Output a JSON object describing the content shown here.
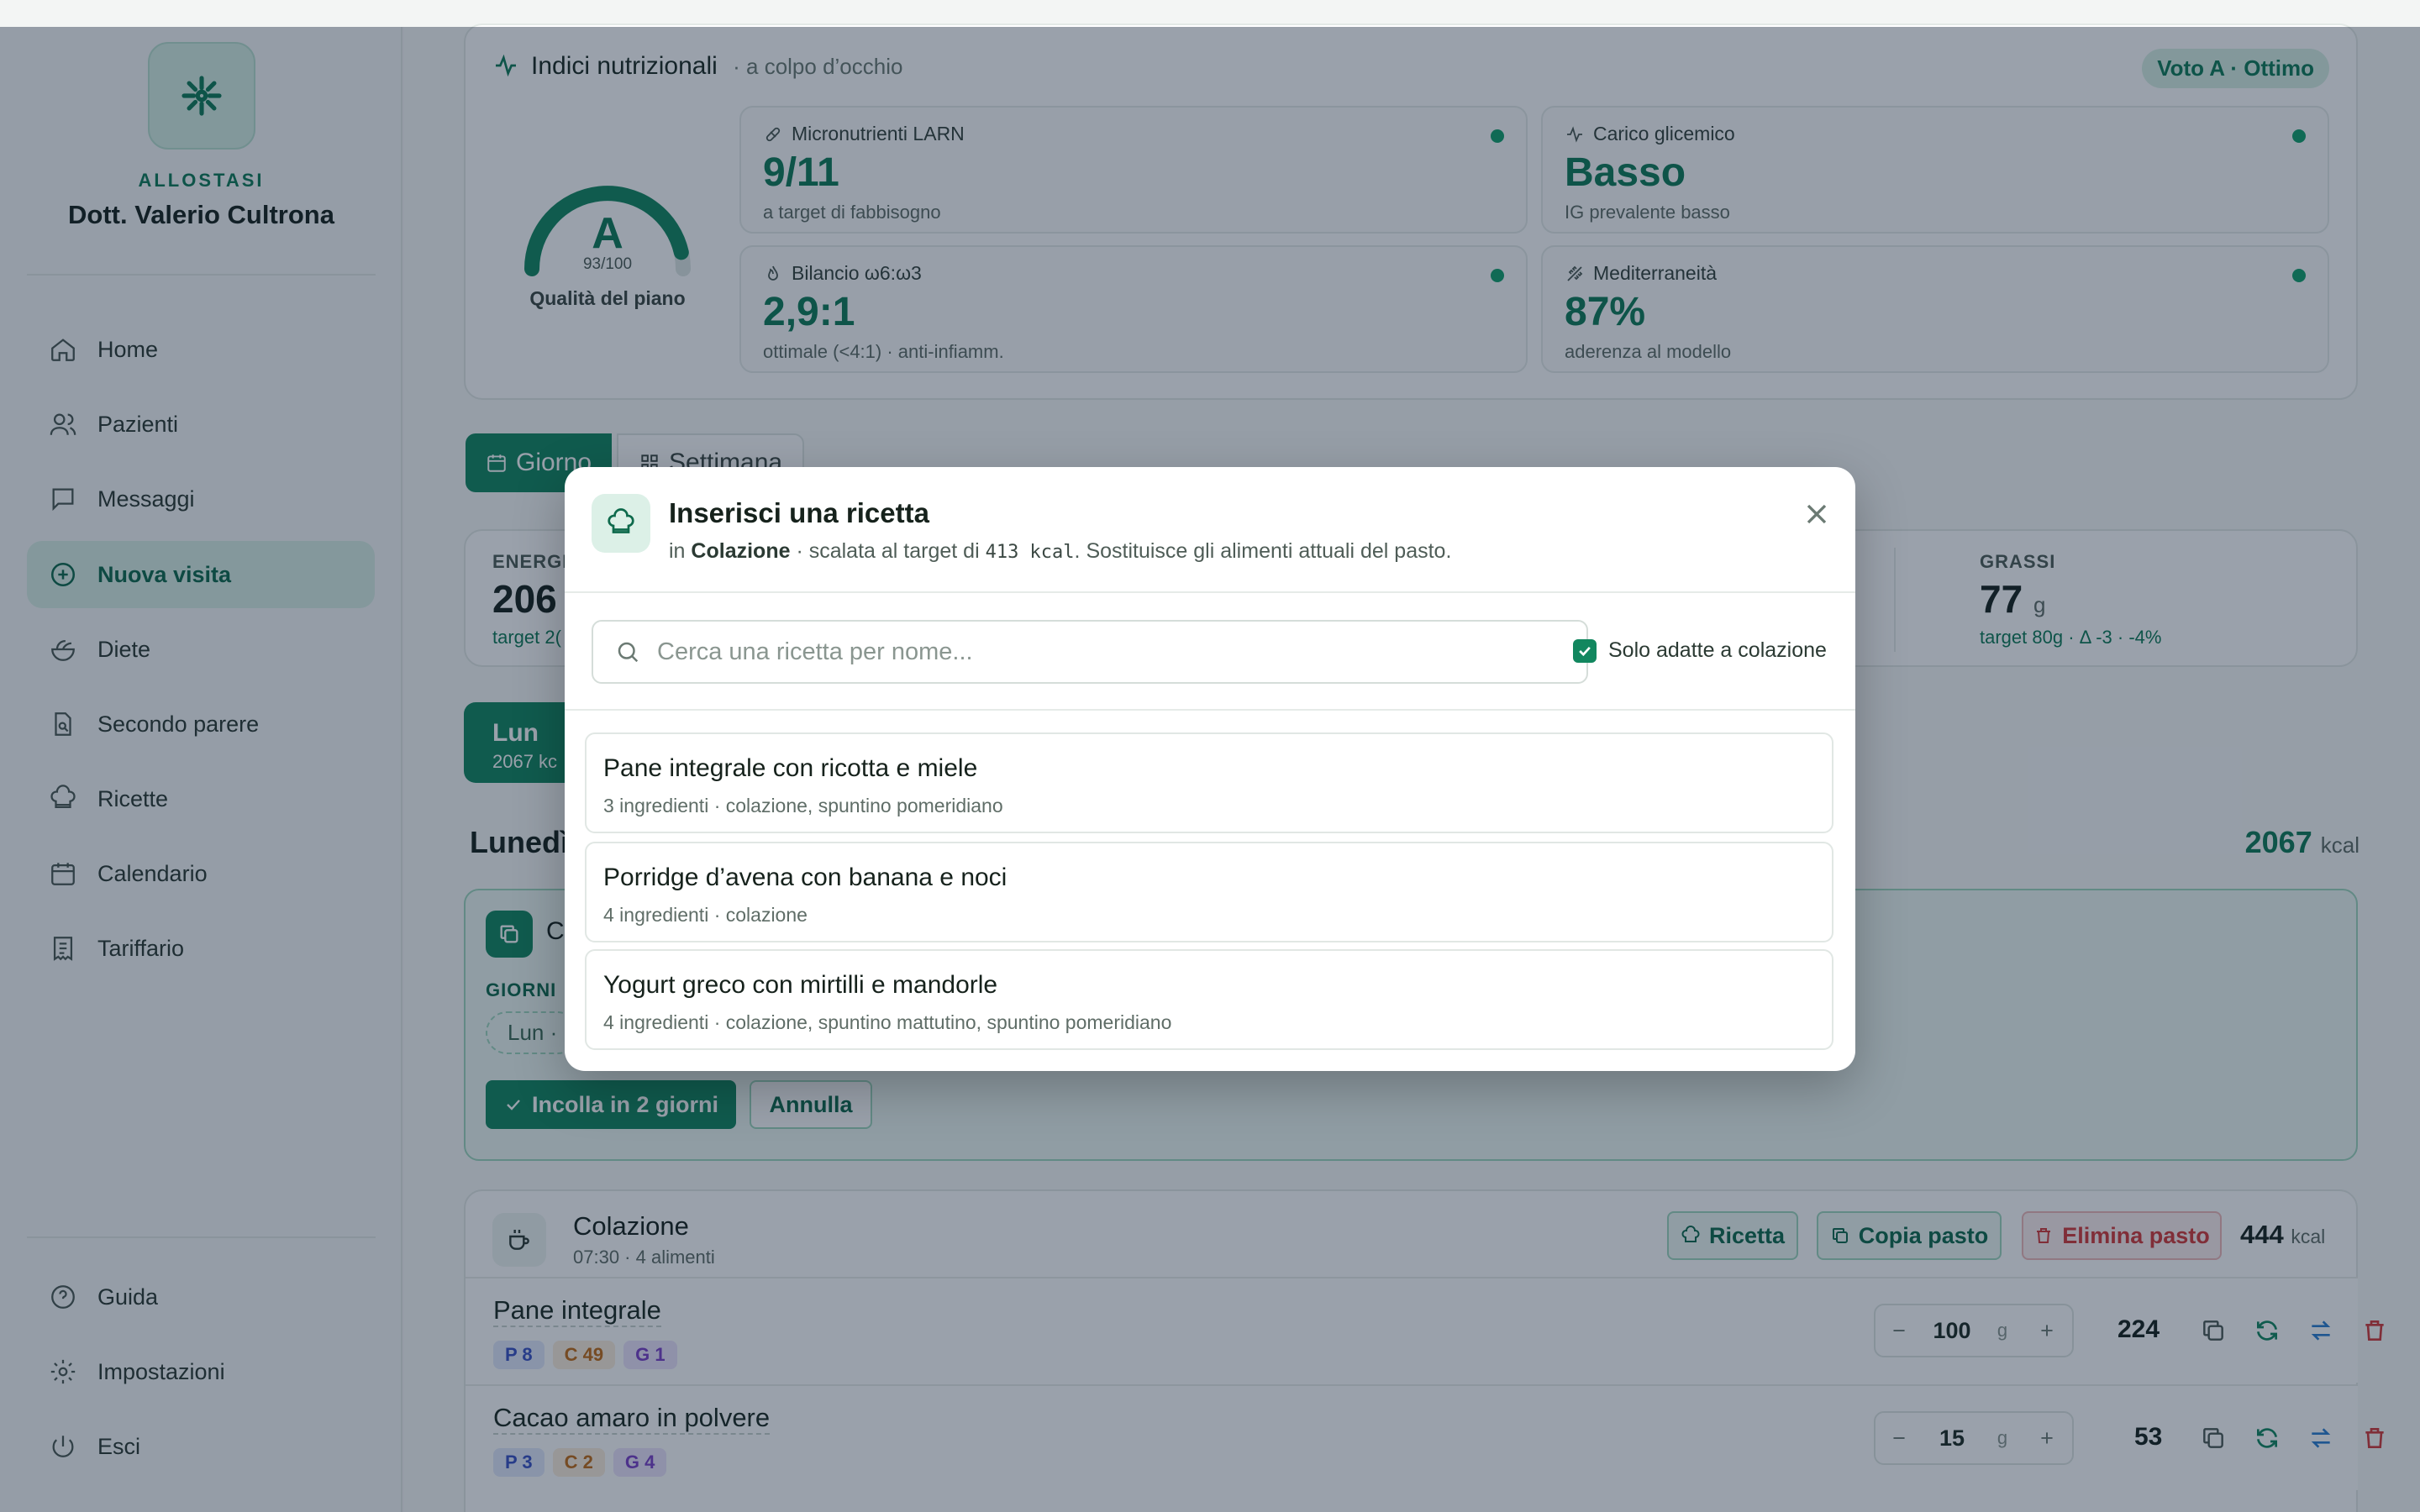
{
  "sidebar": {
    "brand_small": "ALLOSTASI",
    "brand_name": "Dott. Valerio Cultrona",
    "items": [
      {
        "label": "Home",
        "icon": "home-icon"
      },
      {
        "label": "Pazienti",
        "icon": "users-icon"
      },
      {
        "label": "Messaggi",
        "icon": "message-icon"
      },
      {
        "label": "Nuova visita",
        "icon": "plus-circle-icon",
        "active": true
      },
      {
        "label": "Diete",
        "icon": "salad-icon"
      },
      {
        "label": "Secondo parere",
        "icon": "file-search-icon"
      },
      {
        "label": "Ricette",
        "icon": "chef-hat-icon"
      },
      {
        "label": "Calendario",
        "icon": "calendar-icon"
      },
      {
        "label": "Tariffario",
        "icon": "receipt-icon"
      }
    ],
    "bottom_items": [
      {
        "label": "Guida",
        "icon": "help-icon"
      },
      {
        "label": "Impostazioni",
        "icon": "gear-icon"
      },
      {
        "label": "Esci",
        "icon": "power-icon"
      }
    ]
  },
  "indices": {
    "title": "Indici nutrizionali",
    "subtitle": "· a colpo d’occhio",
    "badge": "Voto A · Ottimo",
    "grade": "A",
    "score": "93/100",
    "score_value": 93,
    "quality_label": "Qualità del piano",
    "metrics": [
      {
        "label": "Micronutrienti LARN",
        "value": "9/11",
        "sub": "a target di fabbisogno"
      },
      {
        "label": "Carico glicemico",
        "value": "Basso",
        "sub": "IG prevalente basso"
      },
      {
        "label": "Bilancio ω6:ω3",
        "value": "2,9:1",
        "sub": "ottimale (<4:1) · anti-infiamm."
      },
      {
        "label": "Mediterraneità",
        "value": "87%",
        "sub": "aderenza al modello"
      }
    ]
  },
  "view_tabs": {
    "day": "Giorno",
    "week": "Settimana"
  },
  "macros": {
    "energy_label": "ENERGI",
    "energy_value": "206",
    "energy_sub": "target 2(",
    "fat_label": "GRASSI",
    "fat_value": "77",
    "fat_unit": "g",
    "fat_sub": "target 80g · Δ -3 · -4%"
  },
  "day_chip": {
    "label": "Lun",
    "sub": "2067 kc"
  },
  "day_header": {
    "title": "Lunedì",
    "kcal_value": "2067",
    "kcal_unit": "kcal"
  },
  "copy_panel": {
    "label_partial": "C",
    "days_label": "GIORNI",
    "day_pill": "Lun ·",
    "paste_button": "Incolla in 2 giorni",
    "cancel_button": "Annulla"
  },
  "meal": {
    "title": "Colazione",
    "sub": "07:30 · 4 alimenti",
    "recipe_button": "Ricetta",
    "copy_button": "Copia pasto",
    "delete_button": "Elimina pasto",
    "kcal_value": "444",
    "kcal_unit": "kcal",
    "foods": [
      {
        "name": "Pane integrale",
        "p": "P 8",
        "c": "C 49",
        "g": "G 1",
        "qty": "100",
        "unit": "g",
        "kcal": "224"
      },
      {
        "name": "Cacao amaro in polvere",
        "p": "P 3",
        "c": "C 2",
        "g": "G 4",
        "qty": "15",
        "unit": "g",
        "kcal": "53"
      }
    ]
  },
  "modal": {
    "title": "Inserisci una ricetta",
    "sub_prefix": "in",
    "sub_meal": "Colazione",
    "sub_middle": "· scalata al target di",
    "sub_kcal": "413 kcal",
    "sub_suffix": ". Sostituisce gli alimenti attuali del pasto.",
    "search_placeholder": "Cerca una ricetta per nome...",
    "checkbox_label": "Solo adatte a colazione",
    "recipes": [
      {
        "name": "Pane integrale con ricotta e miele",
        "sub": "3 ingredienti · colazione, spuntino pomeridiano"
      },
      {
        "name": "Porridge d’avena con banana e noci",
        "sub": "4 ingredienti · colazione"
      },
      {
        "name": "Yogurt greco con mirtilli e mandorle",
        "sub": "4 ingredienti · colazione, spuntino mattutino, spuntino pomeridiano"
      }
    ]
  },
  "colors": {
    "accent": "#0e7a57",
    "danger": "#d23a3a",
    "overlay": "rgba(15,30,55,0.42)"
  }
}
